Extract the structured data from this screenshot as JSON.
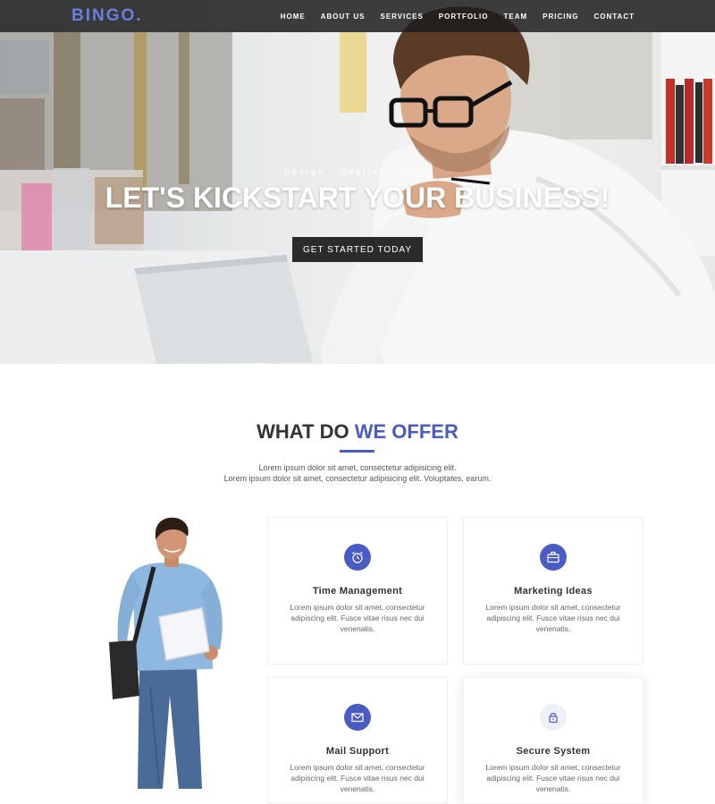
{
  "navbar": {
    "brand": "BINGO",
    "brand_dot": ".",
    "links": [
      "HOME",
      "ABOUT US",
      "SERVICES",
      "PORTFOLIO",
      "TEAM",
      "PRICING",
      "CONTACT"
    ]
  },
  "hero": {
    "tagline": "Design - Degital - Deliv",
    "title": "LET'S KICKSTART YOUR BUSINESS!",
    "cta": "GET STARTED TODAY"
  },
  "offer": {
    "title_main": "WHAT DO ",
    "title_accent": "WE OFFER",
    "subtitle_line1": "Lorem ipsum dolor sit amet, consectetur adipisicing elit.",
    "subtitle_line2": "Lorem ipsum dolor sit amet, consectetur adipisicing elit. Voluptates, earum.",
    "cards": [
      {
        "title": "Time Management",
        "text": "Lorem ipsum dolor sit amet, consectetur adipiscing elit. Fusce vitae risus nec dui venenatis.",
        "icon": "alarm-clock-icon"
      },
      {
        "title": "Marketing Ideas",
        "text": "Lorem ipsum dolor sit amet, consectetur adipiscing elit. Fusce vitae risus nec dui venenatis.",
        "icon": "briefcase-icon"
      },
      {
        "title": "Mail Support",
        "text": "Lorem ipsum dolor sit amet, consectetur adipiscing elit. Fusce vitae risus nec dui venenatis.",
        "icon": "envelope-icon"
      },
      {
        "title": "Secure System",
        "text": "Lorem ipsum dolor sit amet, consectetur adipiscing elit. Fusce vitae risus nec dui venenatis.",
        "icon": "lock-icon"
      }
    ]
  },
  "colors": {
    "accent": "#4a5cc2",
    "brand": "#6a7fe0",
    "navbar_bg": "#1c1c1c",
    "cta_bg": "#2b2b2b"
  }
}
